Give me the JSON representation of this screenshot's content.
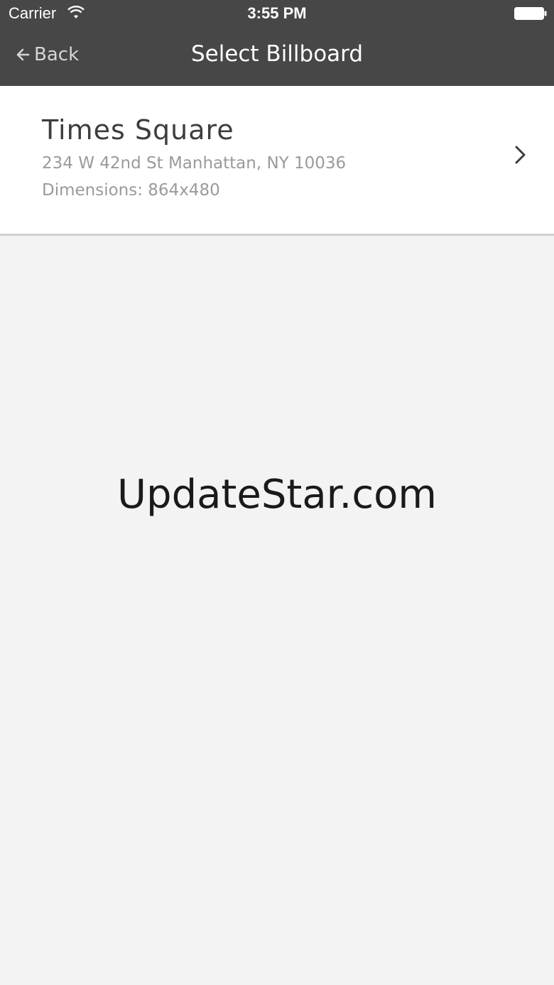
{
  "status_bar": {
    "carrier": "Carrier",
    "time": "3:55 PM",
    "icons": [
      "wifi-icon",
      "battery-icon"
    ]
  },
  "nav": {
    "back_label": "Back",
    "title": "Select Billboard",
    "back_icon": "back-arrow-icon"
  },
  "billboards": [
    {
      "name": "Times Square",
      "address": "234 W 42nd St Manhattan, NY 10036",
      "dimensions": "Dimensions: 864x480",
      "icon": "chevron-right-icon"
    }
  ],
  "watermark": "UpdateStar.com",
  "colors": {
    "navbar_bg": "#474747",
    "list_bg": "#ffffff",
    "page_bg": "#f3f3f3",
    "title_text": "#3d3d3d",
    "secondary_text": "#9a9a9a"
  }
}
